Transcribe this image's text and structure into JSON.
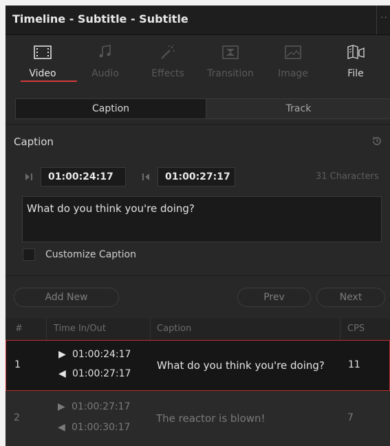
{
  "window": {
    "title": "Timeline - Subtitle - Subtitle",
    "more_label": "··"
  },
  "tabs": [
    {
      "label": "Video",
      "icon": "film-icon",
      "state": "active"
    },
    {
      "label": "Audio",
      "icon": "music-note-icon",
      "state": "disabled"
    },
    {
      "label": "Effects",
      "icon": "magic-wand-icon",
      "state": "disabled"
    },
    {
      "label": "Transition",
      "icon": "transition-icon",
      "state": "disabled"
    },
    {
      "label": "Image",
      "icon": "image-icon",
      "state": "disabled"
    },
    {
      "label": "File",
      "icon": "file-icon",
      "state": "enabled"
    }
  ],
  "segments": {
    "caption": "Caption",
    "track": "Track",
    "selected": "Caption"
  },
  "caption_section": {
    "heading": "Caption",
    "time_in": "01:00:24:17",
    "time_out": "01:00:27:17",
    "char_count": "31 Characters",
    "text": "What do you think you're doing?",
    "customize_label": "Customize Caption",
    "customize_checked": false
  },
  "buttons": {
    "add_new": "Add New",
    "prev": "Prev",
    "next": "Next"
  },
  "table": {
    "headers": {
      "num": "#",
      "time": "Time In/Out",
      "caption": "Caption",
      "cps": "CPS"
    },
    "rows": [
      {
        "num": "1",
        "time_in": "01:00:24:17",
        "time_out": "01:00:27:17",
        "caption": "What do you think you're doing?",
        "cps": "11",
        "selected": true
      },
      {
        "num": "2",
        "time_in": "01:00:27:17",
        "time_out": "01:00:30:17",
        "caption": "The reactor is blown!",
        "cps": "7",
        "selected": false
      }
    ]
  },
  "colors": {
    "accent": "#d23a3a",
    "panel_bg": "#282828",
    "selected_row_border": "#c03030"
  }
}
